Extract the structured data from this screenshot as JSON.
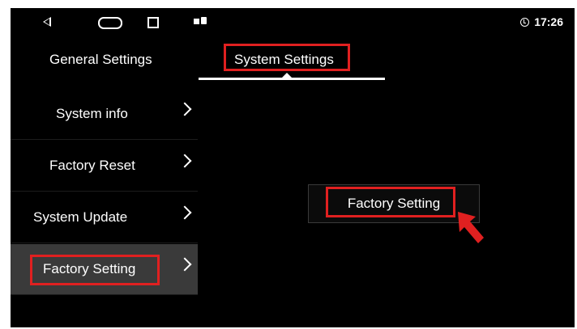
{
  "statusbar": {
    "time": "17:26",
    "icons": [
      "back-icon",
      "home-icon",
      "recent-apps-icon",
      "notification-icon",
      "battery-notification-icon",
      "alarm-icon"
    ]
  },
  "tabs": [
    {
      "label": "General Settings",
      "active": false
    },
    {
      "label": "System Settings",
      "active": true
    }
  ],
  "sidebar": {
    "items": [
      {
        "label": "System info",
        "active": false
      },
      {
        "label": "Factory Reset",
        "active": false
      },
      {
        "label": "System Update",
        "active": false
      },
      {
        "label": "Factory Setting",
        "active": true
      }
    ]
  },
  "content": {
    "button_label": "Factory Setting"
  },
  "colors": {
    "background": "#000000",
    "highlight": "#e02020",
    "active_item": "#3a3a3a",
    "text": "#ffffff"
  }
}
